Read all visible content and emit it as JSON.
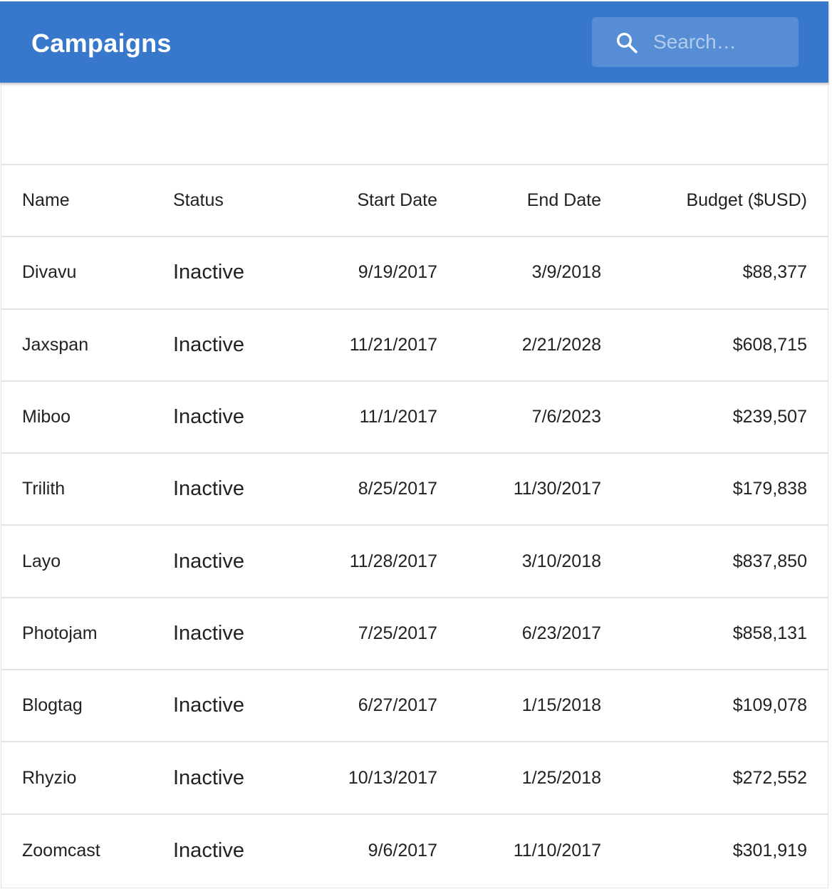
{
  "appbar": {
    "title": "Campaigns",
    "search": {
      "placeholder": "Search…",
      "icon": "search-icon"
    },
    "color": "#3778cc"
  },
  "table": {
    "columns": [
      "Name",
      "Status",
      "Start Date",
      "End Date",
      "Budget ($USD)"
    ],
    "rows": [
      {
        "name": "Divavu",
        "status": "Inactive",
        "start": "9/19/2017",
        "end": "3/9/2018",
        "budget": "$88,377"
      },
      {
        "name": "Jaxspan",
        "status": "Inactive",
        "start": "11/21/2017",
        "end": "2/21/2028",
        "budget": "$608,715"
      },
      {
        "name": "Miboo",
        "status": "Inactive",
        "start": "11/1/2017",
        "end": "7/6/2023",
        "budget": "$239,507"
      },
      {
        "name": "Trilith",
        "status": "Inactive",
        "start": "8/25/2017",
        "end": "11/30/2017",
        "budget": "$179,838"
      },
      {
        "name": "Layo",
        "status": "Inactive",
        "start": "11/28/2017",
        "end": "3/10/2018",
        "budget": "$837,850"
      },
      {
        "name": "Photojam",
        "status": "Inactive",
        "start": "7/25/2017",
        "end": "6/23/2017",
        "budget": "$858,131"
      },
      {
        "name": "Blogtag",
        "status": "Inactive",
        "start": "6/27/2017",
        "end": "1/15/2018",
        "budget": "$109,078"
      },
      {
        "name": "Rhyzio",
        "status": "Inactive",
        "start": "10/13/2017",
        "end": "1/25/2018",
        "budget": "$272,552"
      },
      {
        "name": "Zoomcast",
        "status": "Inactive",
        "start": "9/6/2017",
        "end": "11/10/2017",
        "budget": "$301,919"
      }
    ]
  }
}
